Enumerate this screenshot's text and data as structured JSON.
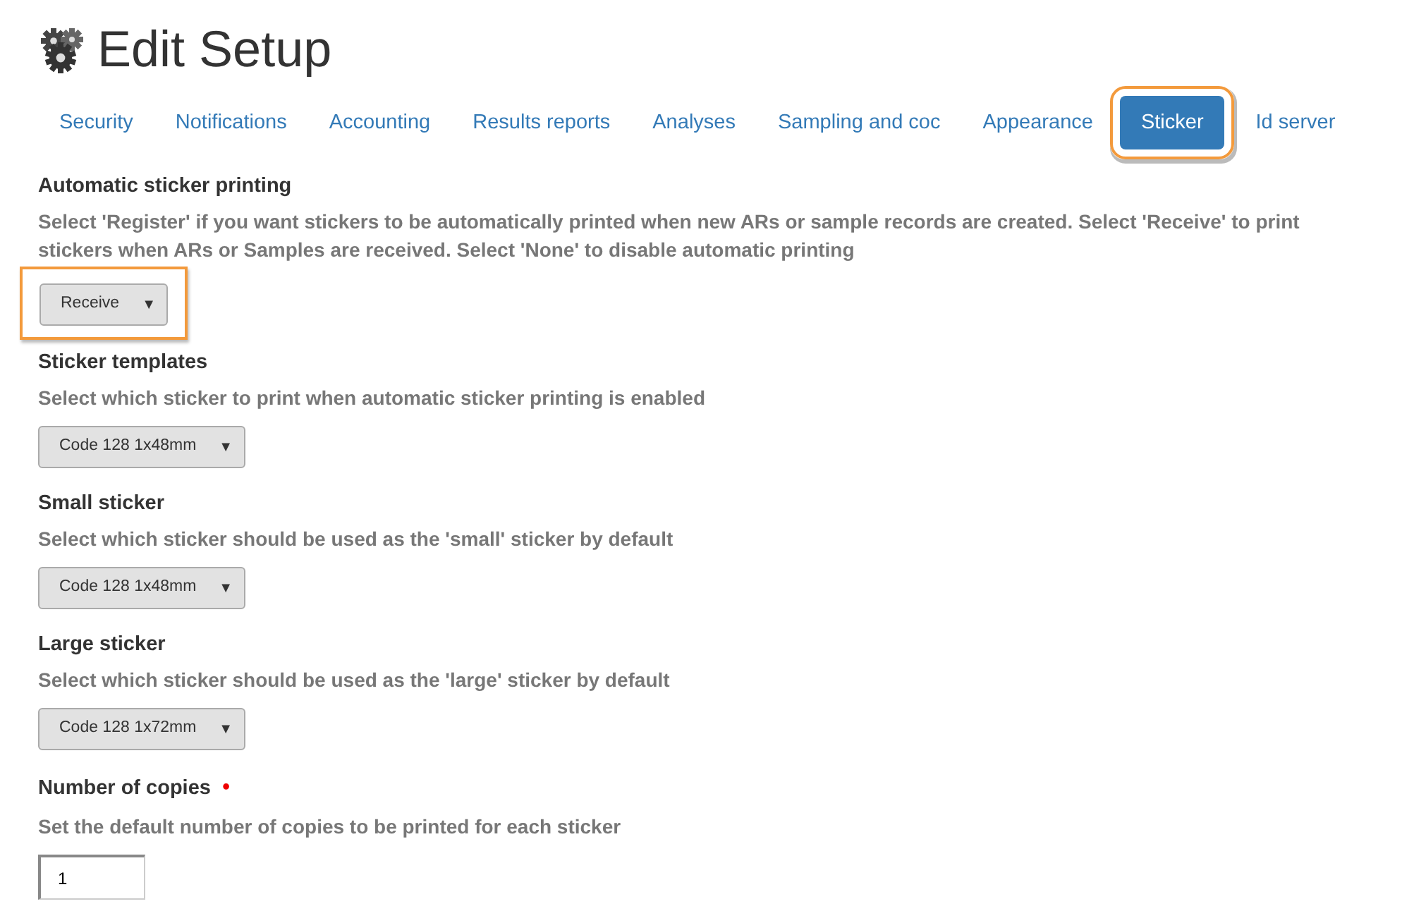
{
  "title": "Edit Setup",
  "tabs": [
    {
      "label": "Security",
      "selected": false,
      "highlighted": false
    },
    {
      "label": "Notifications",
      "selected": false,
      "highlighted": false
    },
    {
      "label": "Accounting",
      "selected": false,
      "highlighted": false
    },
    {
      "label": "Results reports",
      "selected": false,
      "highlighted": false
    },
    {
      "label": "Analyses",
      "selected": false,
      "highlighted": false
    },
    {
      "label": "Sampling and coc",
      "selected": false,
      "highlighted": false
    },
    {
      "label": "Appearance",
      "selected": false,
      "highlighted": false
    },
    {
      "label": "Sticker",
      "selected": true,
      "highlighted": true
    },
    {
      "label": "Id server",
      "selected": false,
      "highlighted": false
    }
  ],
  "fields": [
    {
      "kind": "select",
      "label": "Automatic sticker printing",
      "help": "Select 'Register' if you want stickers to be automatically printed when new ARs or sample records are created. Select 'Receive' to print stickers when ARs or Samples are received. Select 'None' to disable automatic printing",
      "value": "Receive",
      "arrow": "▼",
      "highlighted": true
    },
    {
      "kind": "select",
      "label": "Sticker templates",
      "help": "Select which sticker to print when automatic sticker printing is enabled",
      "value": "Code 128 1x48mm",
      "arrow": "▼"
    },
    {
      "kind": "select",
      "label": "Small sticker",
      "help": "Select which sticker should be used as the 'small' sticker by default",
      "value": "Code 128 1x48mm",
      "arrow": "▼"
    },
    {
      "kind": "select",
      "label": "Large sticker",
      "help": "Select which sticker should be used as the 'large' sticker by default",
      "value": "Code 128 1x72mm",
      "arrow": "▼"
    },
    {
      "kind": "number",
      "label": "Number of copies",
      "required_mark": "•",
      "help": "Set the default number of copies to be printed for each sticker",
      "value": "1"
    }
  ]
}
